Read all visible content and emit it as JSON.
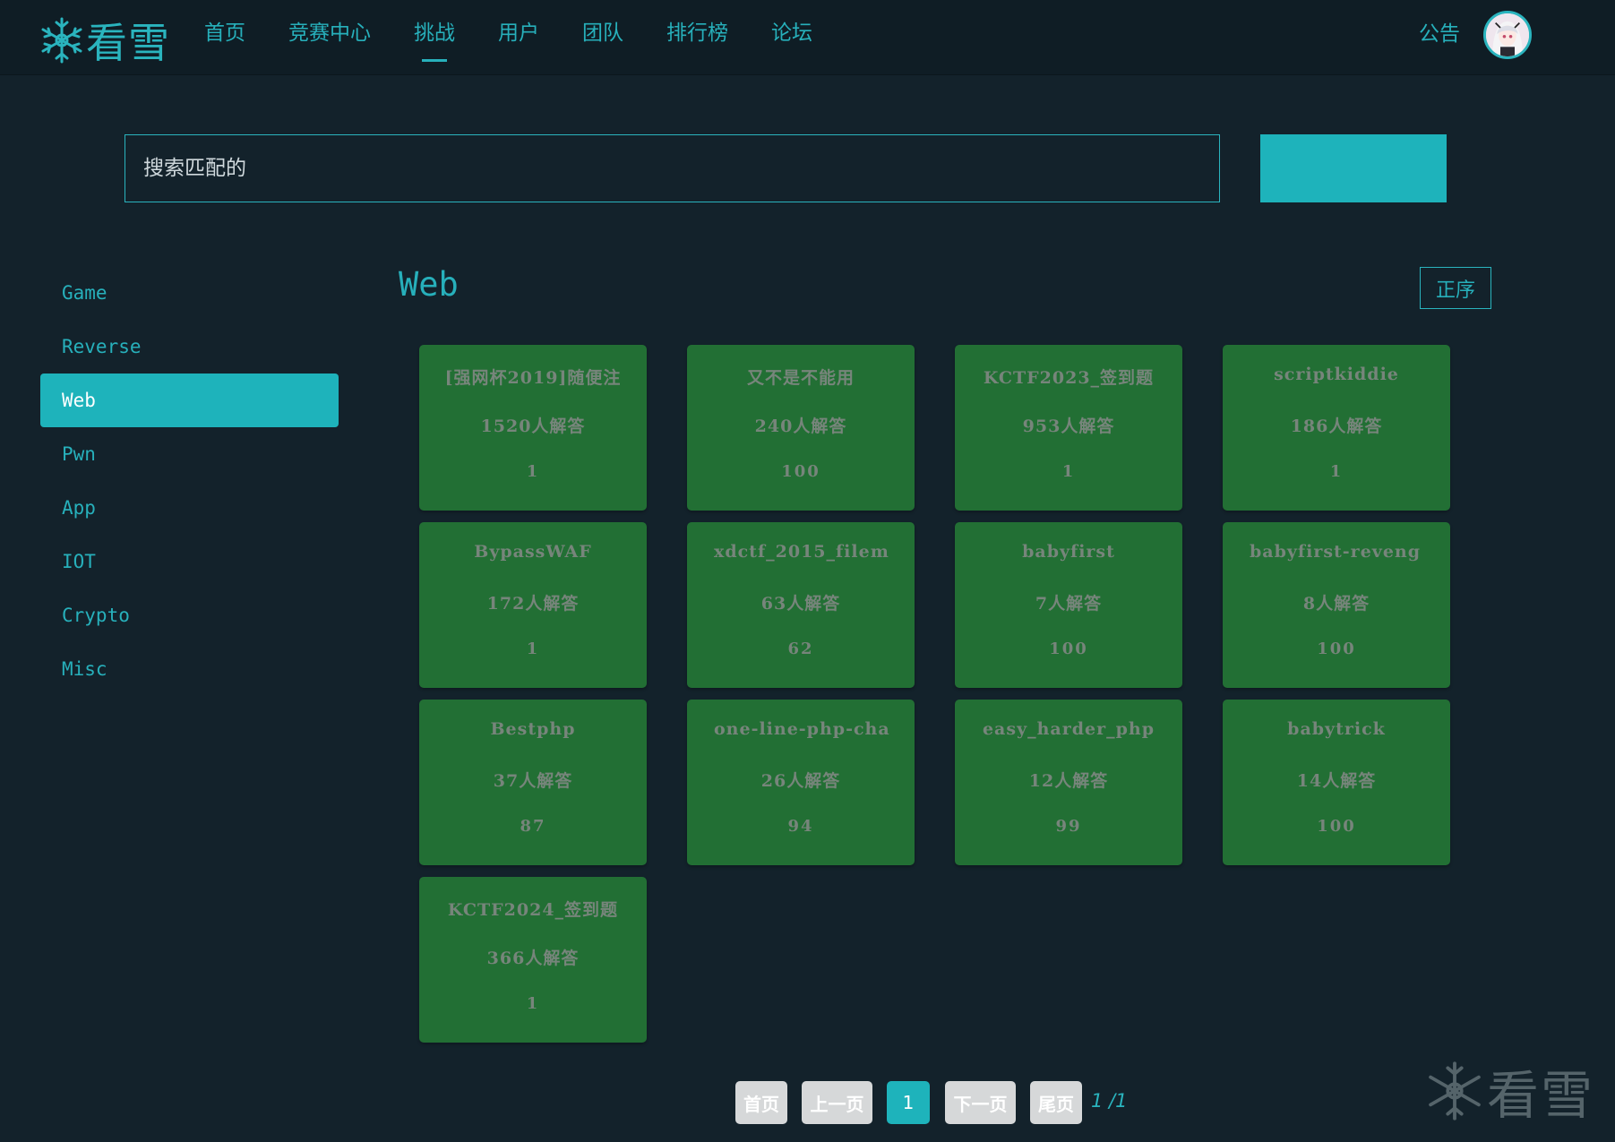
{
  "brand": {
    "logo_text": "看雪"
  },
  "nav": {
    "items": [
      {
        "label": "首页",
        "active": false
      },
      {
        "label": "竞赛中心",
        "active": false
      },
      {
        "label": "挑战",
        "active": true
      },
      {
        "label": "用户",
        "active": false
      },
      {
        "label": "团队",
        "active": false
      },
      {
        "label": "排行榜",
        "active": false
      },
      {
        "label": "论坛",
        "active": false
      }
    ],
    "notice_label": "公告"
  },
  "search": {
    "placeholder": "搜索匹配的",
    "value": ""
  },
  "sidebar": {
    "items": [
      {
        "label": "Game",
        "active": false
      },
      {
        "label": "Reverse",
        "active": false
      },
      {
        "label": "Web",
        "active": true
      },
      {
        "label": "Pwn",
        "active": false
      },
      {
        "label": "App",
        "active": false
      },
      {
        "label": "IOT",
        "active": false
      },
      {
        "label": "Crypto",
        "active": false
      },
      {
        "label": "Misc",
        "active": false
      }
    ]
  },
  "section": {
    "title": "Web",
    "sort_label": "正序"
  },
  "challenges": [
    {
      "title": "[强网杯2019]随便注",
      "solves": "1520人解答",
      "score": "1"
    },
    {
      "title": "又不是不能用",
      "solves": "240人解答",
      "score": "100"
    },
    {
      "title": "KCTF2023_签到题",
      "solves": "953人解答",
      "score": "1"
    },
    {
      "title": "scriptkiddie",
      "solves": "186人解答",
      "score": "1"
    },
    {
      "title": "BypassWAF",
      "solves": "172人解答",
      "score": "1"
    },
    {
      "title": "xdctf_2015_filem",
      "solves": "63人解答",
      "score": "62"
    },
    {
      "title": "babyfirst",
      "solves": "7人解答",
      "score": "100"
    },
    {
      "title": "babyfirst-reveng",
      "solves": "8人解答",
      "score": "100"
    },
    {
      "title": "Bestphp",
      "solves": "37人解答",
      "score": "87"
    },
    {
      "title": "one-line-php-cha",
      "solves": "26人解答",
      "score": "94"
    },
    {
      "title": "easy_harder_php",
      "solves": "12人解答",
      "score": "99"
    },
    {
      "title": "babytrick",
      "solves": "14人解答",
      "score": "100"
    },
    {
      "title": "KCTF2024_签到题",
      "solves": "366人解答",
      "score": "1"
    }
  ],
  "pagination": {
    "first": "首页",
    "prev": "上一页",
    "current": "1",
    "next": "下一页",
    "last": "尾页",
    "info": "1 /1"
  },
  "colors": {
    "accent": "#1eb3bb",
    "background": "#13222b",
    "card": "#226f34"
  },
  "icons": {
    "logo": "snowflake-icon",
    "watermark": "snowflake-icon"
  },
  "watermark": {
    "text": "看雪"
  }
}
